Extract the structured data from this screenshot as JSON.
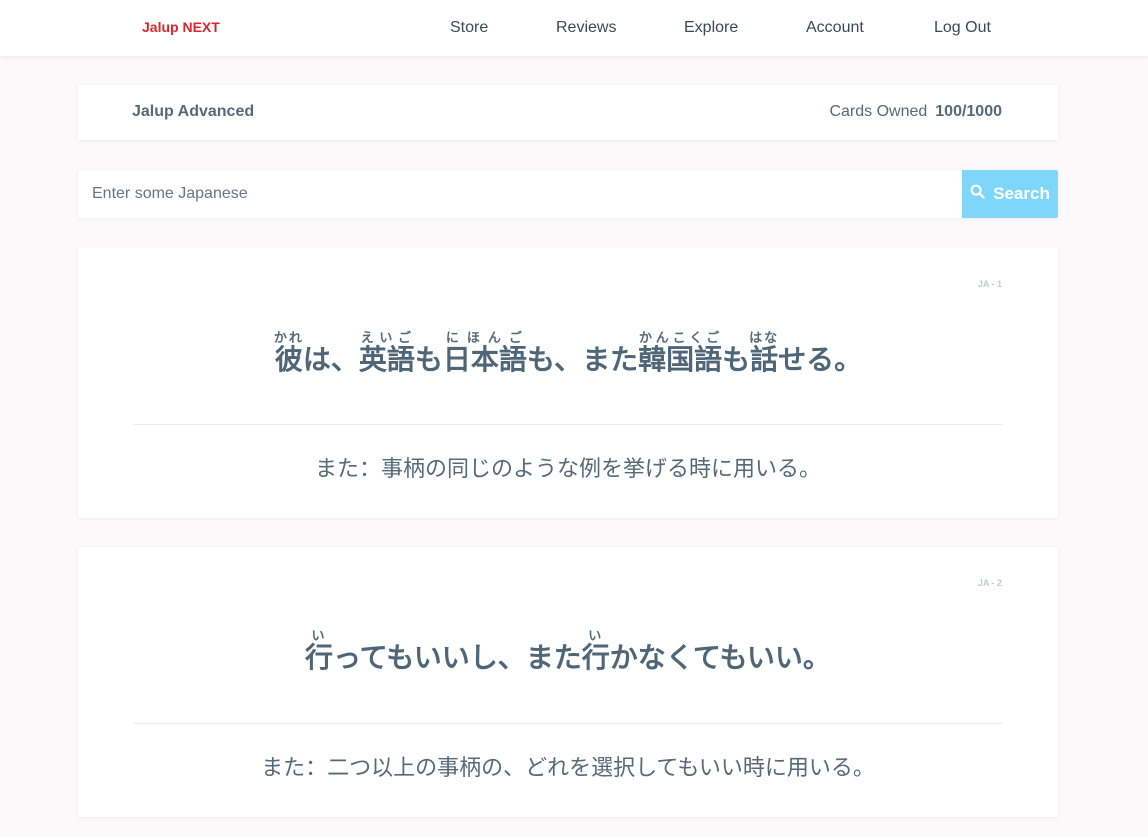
{
  "navbar": {
    "brand": "Jalup NEXT",
    "links": [
      {
        "label": "Store"
      },
      {
        "label": "Reviews"
      },
      {
        "label": "Explore"
      },
      {
        "label": "Account"
      },
      {
        "label": "Log Out"
      }
    ]
  },
  "deck": {
    "title": "Jalup Advanced",
    "cards_owned_label": "Cards Owned",
    "cards_owned_value": "100/1000"
  },
  "search": {
    "placeholder": "Enter some Japanese",
    "value": "",
    "button_label": "Search",
    "button_icon": "search-icon",
    "button_color": "#7fd6fb"
  },
  "colors": {
    "brand": "#d9262c",
    "text": "#56697a",
    "background": "#fcf9fa"
  },
  "cards": [
    {
      "id": "JA - 1",
      "sentence": [
        {
          "base": "彼",
          "ruby": "かれ"
        },
        {
          "text": "は、"
        },
        {
          "base": "英語",
          "ruby": "えいご"
        },
        {
          "text": "も"
        },
        {
          "base": "日本語",
          "ruby": "にほんご"
        },
        {
          "text": "も、また"
        },
        {
          "base": "韓国語",
          "ruby": "かんこくご"
        },
        {
          "text": "も"
        },
        {
          "base": "話",
          "ruby": "はな"
        },
        {
          "text": "せる。"
        }
      ],
      "meaning": "また：事柄の同じのような例を挙げる時に用いる。"
    },
    {
      "id": "JA - 2",
      "sentence": [
        {
          "base": "行",
          "ruby": "い"
        },
        {
          "text": "ってもいいし、また"
        },
        {
          "base": "行",
          "ruby": "い"
        },
        {
          "text": "かなくてもいい。"
        }
      ],
      "meaning": "また：二つ以上の事柄の、どれを選択してもいい時に用いる。"
    }
  ]
}
